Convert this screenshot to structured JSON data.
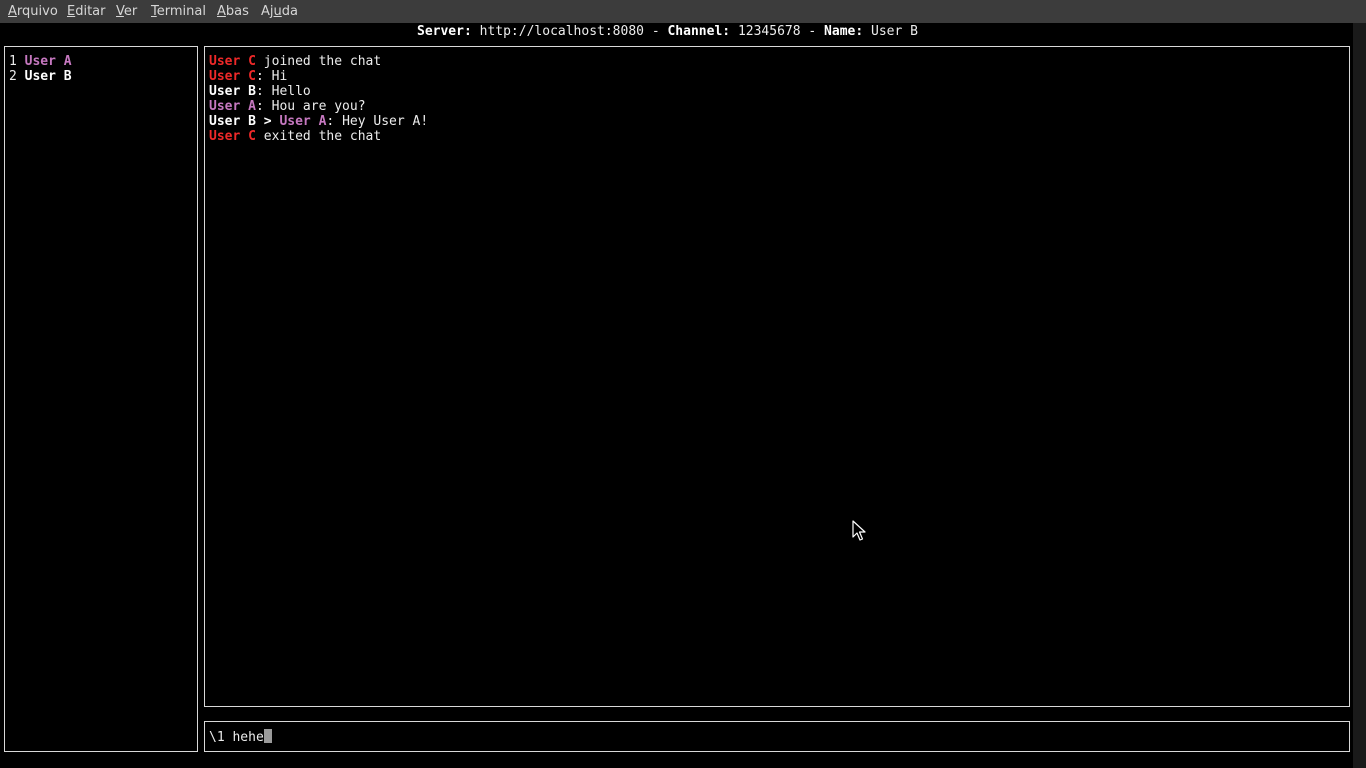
{
  "menubar": {
    "items": [
      {
        "mnemonic": "A",
        "rest": "rquivo"
      },
      {
        "mnemonic": "E",
        "rest": "ditar"
      },
      {
        "mnemonic": "V",
        "rest": "er"
      },
      {
        "mnemonic": "T",
        "rest": "erminal"
      },
      {
        "mnemonic": "A",
        "rest": "bas"
      },
      {
        "pre": "Aj",
        "mnemonic": "u",
        "rest": "da"
      }
    ]
  },
  "status": {
    "server_label": "Server:",
    "server_value": "http://localhost:8080",
    "sep1": " - ",
    "channel_label": "Channel:",
    "channel_value": "12345678",
    "sep2": " - ",
    "name_label": "Name:",
    "name_value": "User B"
  },
  "users": [
    {
      "num": "1",
      "name": "User A",
      "color": "#c678c0"
    },
    {
      "num": "2",
      "name": "User B",
      "color": "#ffffff"
    }
  ],
  "messages": [
    {
      "user": "User C",
      "text": " joined the chat"
    },
    {
      "user": "User C",
      "text": ": Hi"
    },
    {
      "user": "User B",
      "text": ": Hello"
    },
    {
      "user": "User A",
      "text": ": Hou are you?"
    },
    {
      "user": "User B",
      "arrow": " > ",
      "target": "User A",
      "text": ": Hey User A!"
    },
    {
      "user": "User C",
      "text": " exited the chat"
    }
  ],
  "user_colors": {
    "User A": "#c678c0",
    "User B": "#ffffff",
    "User C": "#ef2929"
  },
  "input": {
    "value": "\\1 hehe"
  }
}
